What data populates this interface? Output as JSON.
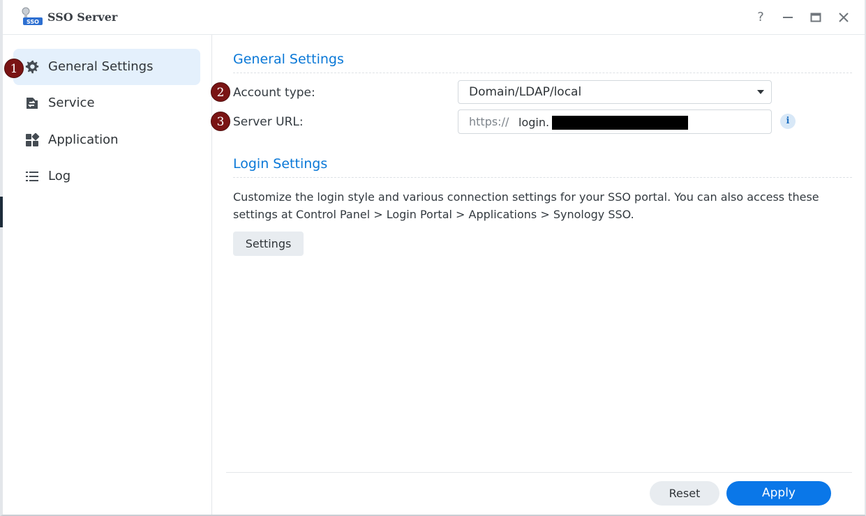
{
  "window": {
    "title": "SSO Server",
    "icon_label": "SSO",
    "controls": {
      "help": "?",
      "minimize": "—",
      "maximize": "□",
      "close": "✕"
    }
  },
  "sidebar": {
    "items": [
      {
        "label": "General Settings",
        "icon": "gear-icon",
        "active": true
      },
      {
        "label": "Service",
        "icon": "service-icon"
      },
      {
        "label": "Application",
        "icon": "application-icon"
      },
      {
        "label": "Log",
        "icon": "list-icon"
      }
    ]
  },
  "badges": [
    "1",
    "2",
    "3"
  ],
  "general": {
    "title": "General Settings",
    "account_type_label": "Account type:",
    "account_type_value": "Domain/LDAP/local",
    "server_url_label": "Server URL:",
    "server_url_prefix": "https://",
    "server_url_value": "login."
  },
  "login": {
    "title": "Login Settings",
    "description": "Customize the login style and various connection settings for your SSO portal. You can also access these settings at Control Panel > Login Portal > Applications > Synology SSO.",
    "settings_button": "Settings"
  },
  "footer": {
    "reset": "Reset",
    "apply": "Apply"
  },
  "colors": {
    "accent": "#0a77e8",
    "section_title": "#0a78d7",
    "active_item_bg": "#e4f0fc",
    "badge": "#7a1414"
  }
}
